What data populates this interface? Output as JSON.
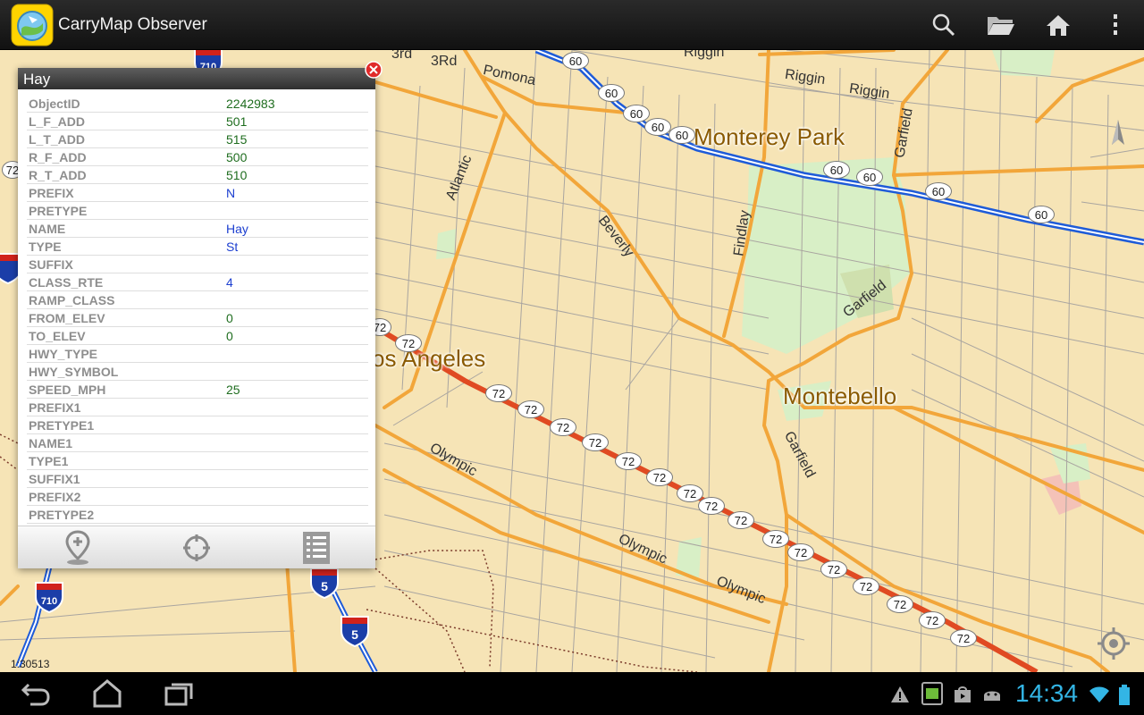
{
  "app": {
    "title": "CarryMap Observer"
  },
  "toolbar": {
    "search_icon": "search-icon",
    "open_icon": "folder-open-icon",
    "home_icon": "home-icon",
    "overflow_icon": "overflow-menu-icon"
  },
  "map": {
    "cities": [
      {
        "name": "Monterey Park"
      },
      {
        "name": "Montebello"
      },
      {
        "name": "os Angeles"
      }
    ],
    "streets": [
      "3rd",
      "3Rd",
      "Pomona",
      "Riggin",
      "Riggin",
      "Riggin",
      "Atlantic",
      "Beverly",
      "Findlay",
      "Garfield",
      "Garfield",
      "Garfield",
      "Olympic",
      "Olympic",
      "Olympic"
    ],
    "highway_60_label": "60",
    "highway_72_label": "72",
    "highway_partial_label": "72",
    "interstate_710_label": "710",
    "interstate_5_label": "5",
    "scale": "1:30513",
    "colors": {
      "background": "#f6e4b6",
      "major_road": "#f2a63a",
      "minor_road": "#a9a5a0",
      "highway_blue": "#1e5bd8",
      "highway_red": "#e04a22",
      "park": "#d8efc6"
    }
  },
  "panel": {
    "title": "Hay",
    "attributes": [
      {
        "key": "ObjectID",
        "value": "2242983",
        "kind": "num"
      },
      {
        "key": "L_F_ADD",
        "value": "501",
        "kind": "num"
      },
      {
        "key": "L_T_ADD",
        "value": "515",
        "kind": "num"
      },
      {
        "key": "R_F_ADD",
        "value": "500",
        "kind": "num"
      },
      {
        "key": "R_T_ADD",
        "value": "510",
        "kind": "num"
      },
      {
        "key": "PREFIX",
        "value": "N",
        "kind": "str"
      },
      {
        "key": "PRETYPE",
        "value": "",
        "kind": "str"
      },
      {
        "key": "NAME",
        "value": "Hay",
        "kind": "str"
      },
      {
        "key": "TYPE",
        "value": "St",
        "kind": "str"
      },
      {
        "key": "SUFFIX",
        "value": "",
        "kind": "str"
      },
      {
        "key": "CLASS_RTE",
        "value": "4",
        "kind": "str"
      },
      {
        "key": "RAMP_CLASS",
        "value": "",
        "kind": "str"
      },
      {
        "key": "FROM_ELEV",
        "value": "0",
        "kind": "num"
      },
      {
        "key": "TO_ELEV",
        "value": "0",
        "kind": "num"
      },
      {
        "key": "HWY_TYPE",
        "value": "",
        "kind": "str"
      },
      {
        "key": "HWY_SYMBOL",
        "value": "",
        "kind": "str"
      },
      {
        "key": "SPEED_MPH",
        "value": "25",
        "kind": "num"
      },
      {
        "key": "PREFIX1",
        "value": "",
        "kind": "str"
      },
      {
        "key": "PRETYPE1",
        "value": "",
        "kind": "str"
      },
      {
        "key": "NAME1",
        "value": "",
        "kind": "str"
      },
      {
        "key": "TYPE1",
        "value": "",
        "kind": "str"
      },
      {
        "key": "SUFFIX1",
        "value": "",
        "kind": "str"
      },
      {
        "key": "PREFIX2",
        "value": "",
        "kind": "str"
      },
      {
        "key": "PRETYPE2",
        "value": "",
        "kind": "str"
      }
    ],
    "colors": {
      "num": "#1f6d1f",
      "str": "#1c3fd0",
      "key": "#8e8e8e"
    },
    "footer_icons": [
      "add-pin-icon",
      "locate-target-icon",
      "list-icon"
    ]
  },
  "system": {
    "time": "14:34",
    "nav_icons": [
      "back-icon",
      "home-icon",
      "recent-apps-icon"
    ],
    "status_icons": [
      "warning-icon",
      "screenshot-icon",
      "store-icon",
      "android-debug-icon",
      "wifi-icon",
      "battery-icon"
    ]
  }
}
